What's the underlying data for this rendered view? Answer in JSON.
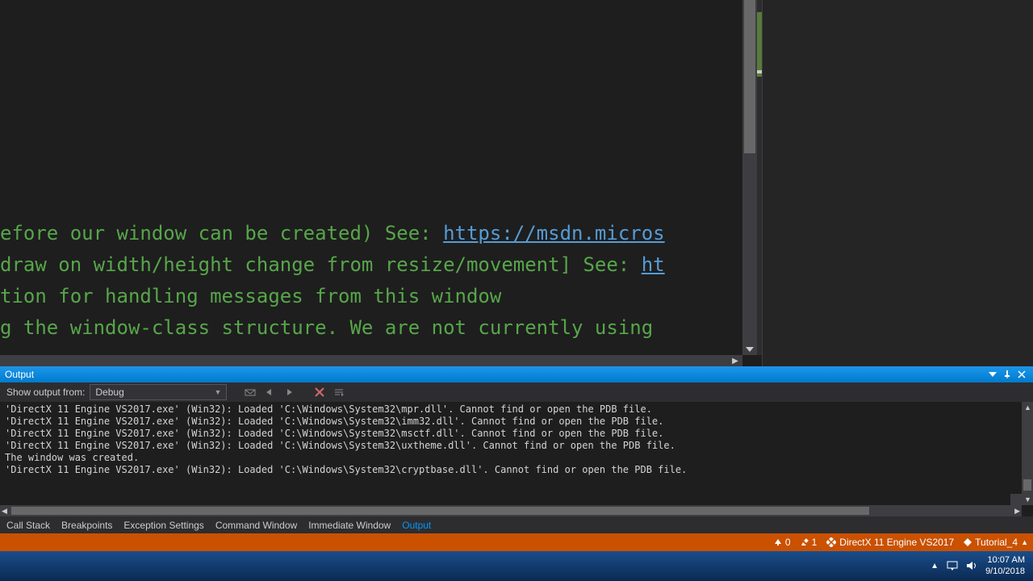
{
  "editor": {
    "lines": [
      {
        "text": "efore our window can be created) See: ",
        "link": "https://msdn.micros"
      },
      {
        "text": "draw on width/height change from resize/movement] See: ",
        "link": "ht"
      },
      {
        "text": "tion for handling messages from this window",
        "link": ""
      },
      {
        "text": "g the window-class structure. We are not currently using",
        "link": ""
      }
    ]
  },
  "output": {
    "title": "Output",
    "show_from_label": "Show output from:",
    "dropdown_value": "Debug",
    "lines": [
      "'DirectX 11 Engine VS2017.exe' (Win32): Loaded 'C:\\Windows\\System32\\mpr.dll'. Cannot find or open the PDB file.",
      "'DirectX 11 Engine VS2017.exe' (Win32): Loaded 'C:\\Windows\\System32\\imm32.dll'. Cannot find or open the PDB file.",
      "'DirectX 11 Engine VS2017.exe' (Win32): Loaded 'C:\\Windows\\System32\\msctf.dll'. Cannot find or open the PDB file.",
      "'DirectX 11 Engine VS2017.exe' (Win32): Loaded 'C:\\Windows\\System32\\uxtheme.dll'. Cannot find or open the PDB file.",
      "The window was created.",
      "'DirectX 11 Engine VS2017.exe' (Win32): Loaded 'C:\\Windows\\System32\\cryptbase.dll'. Cannot find or open the PDB file."
    ]
  },
  "panel_tabs": [
    "Call Stack",
    "Breakpoints",
    "Exception Settings",
    "Command Window",
    "Immediate Window",
    "Output"
  ],
  "panel_tabs_active": 5,
  "status": {
    "up_count": "0",
    "edit_count": "1",
    "project": "DirectX 11 Engine VS2017",
    "config": "Tutorial_4"
  },
  "taskbar": {
    "time": "10:07 AM",
    "date": "9/10/2018"
  }
}
